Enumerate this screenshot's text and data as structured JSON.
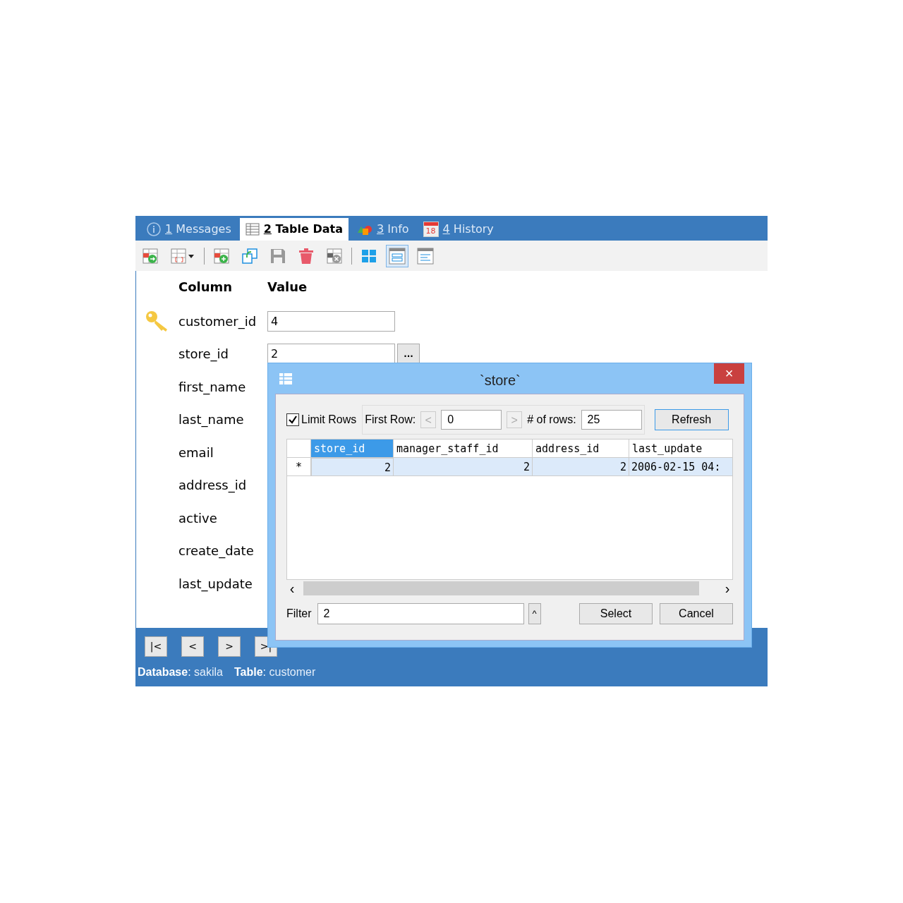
{
  "tabs": [
    {
      "number": "1",
      "label": "Messages",
      "selected": false
    },
    {
      "number": "2",
      "label": "Table Data",
      "selected": true
    },
    {
      "number": "3",
      "label": "Info",
      "selected": false
    },
    {
      "number": "4",
      "label": "History",
      "selected": false,
      "icon_text": "18"
    }
  ],
  "toolbar": [
    {
      "kind": "add-row"
    },
    {
      "kind": "filter-dropdown"
    },
    {
      "kind": "separator"
    },
    {
      "kind": "insert-row"
    },
    {
      "kind": "duplicate"
    },
    {
      "kind": "save"
    },
    {
      "kind": "delete"
    },
    {
      "kind": "cancel"
    },
    {
      "kind": "separator"
    },
    {
      "kind": "grid-view",
      "selected": false
    },
    {
      "kind": "form-view",
      "selected": true
    },
    {
      "kind": "text-view",
      "selected": false
    }
  ],
  "form": {
    "column_header": "Column",
    "value_header": "Value",
    "rows": [
      {
        "kind": "key",
        "label": "customer_id",
        "value": "4"
      },
      {
        "kind": "lookup",
        "label": "store_id",
        "value": "2",
        "browse_label": "..."
      },
      {
        "kind": "plain",
        "label": "first_name"
      },
      {
        "kind": "plain",
        "label": "last_name"
      },
      {
        "kind": "plain",
        "label": "email"
      },
      {
        "kind": "plain",
        "label": "address_id"
      },
      {
        "kind": "plain",
        "label": "active"
      },
      {
        "kind": "plain",
        "label": "create_date"
      },
      {
        "kind": "plain",
        "label": "last_update"
      }
    ]
  },
  "nav_buttons": [
    "|<",
    "<",
    ">",
    ">|"
  ],
  "status_bar": [
    {
      "key": "Database",
      "sep": ":",
      "value": "sakila"
    },
    {
      "key": "Table",
      "sep": ":",
      "value": "customer"
    }
  ],
  "dialog": {
    "title": "`store`",
    "close": "×",
    "limit_rows": {
      "label": "Limit Rows",
      "checked": true
    },
    "first_row": {
      "label": "First Row:",
      "prev": "<",
      "value": "0",
      "next": ">"
    },
    "num_rows": {
      "label": "# of rows:",
      "value": "25"
    },
    "refresh": "Refresh",
    "grid": {
      "columns": [
        {
          "label": "store_id",
          "selected": true
        },
        {
          "label": "manager_staff_id",
          "selected": false
        },
        {
          "label": "address_id",
          "selected": false
        },
        {
          "label": "last_update",
          "selected": false
        }
      ],
      "rows": [
        {
          "marker": "*",
          "cells": [
            "2",
            "2",
            "2",
            "2006-02-15 04:"
          ]
        }
      ]
    },
    "scroll_left": "‹",
    "scroll_right": "›",
    "filter": {
      "label": "Filter",
      "value": "2",
      "up": "^"
    },
    "buttons": [
      "Select",
      "Cancel"
    ]
  }
}
